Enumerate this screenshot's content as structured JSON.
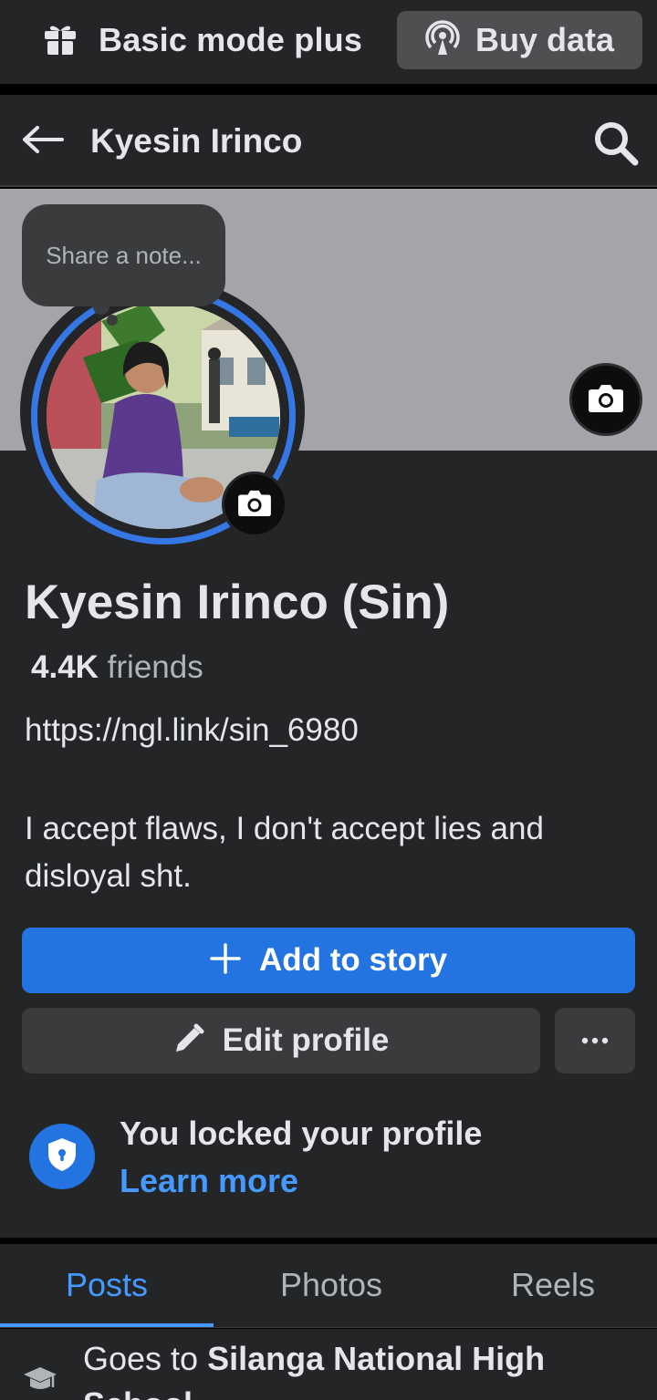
{
  "top_bar": {
    "basic_mode_label": "Basic mode plus",
    "buy_data_label": "Buy data"
  },
  "nav": {
    "title": "Kyesin Irinco"
  },
  "note": {
    "placeholder": "Share a note..."
  },
  "profile": {
    "name": "Kyesin Irinco (Sin)",
    "friends_count": "4.4K",
    "friends_label": "friends",
    "bio_link": "https://ngl.link/sin_6980",
    "bio_text": "I accept flaws, I don't accept lies and disloyal sht."
  },
  "actions": {
    "add_story_label": "Add to story",
    "edit_profile_label": "Edit profile"
  },
  "lock_notice": {
    "title": "You locked your profile",
    "link": "Learn more"
  },
  "tabs": [
    {
      "label": "Posts",
      "active": true
    },
    {
      "label": "Photos",
      "active": false
    },
    {
      "label": "Reels",
      "active": false
    }
  ],
  "intro": {
    "prefix": "Goes to ",
    "school": "Silanga National High School"
  },
  "colors": {
    "accent_blue": "#2374e1",
    "link_blue": "#4599ff",
    "background": "#242526",
    "cover_gray": "#a3a5aa"
  },
  "icons": {
    "gift": "gift-icon",
    "broadcast": "broadcast-icon",
    "back": "back-arrow-icon",
    "search": "search-icon",
    "camera": "camera-icon",
    "plus": "plus-icon",
    "pencil": "pencil-icon",
    "more": "more-dots-icon",
    "shield": "shield-lock-icon",
    "graduation": "graduation-cap-icon"
  }
}
